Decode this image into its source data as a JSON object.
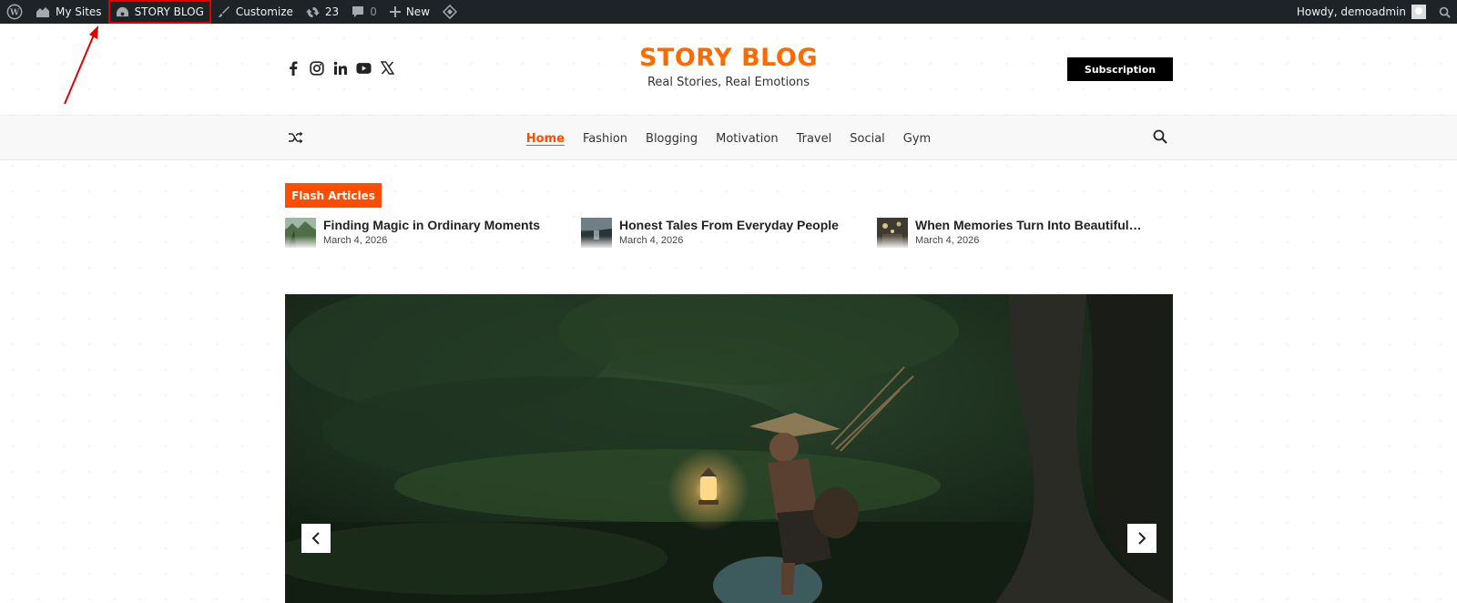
{
  "adminbar": {
    "my_sites": "My Sites",
    "site_name": "STORY BLOG",
    "customize": "Customize",
    "updates_count": "23",
    "comments_count": "0",
    "new": "New",
    "howdy": "Howdy, demoadmin"
  },
  "header": {
    "site_title": "STORY BLOG",
    "tagline": "Real Stories, Real Emotions",
    "subscribe_label": "Subscription",
    "social": [
      "facebook-icon",
      "instagram-icon",
      "linkedin-icon",
      "youtube-icon",
      "x-icon"
    ]
  },
  "nav": {
    "items": [
      {
        "label": "Home",
        "active": true
      },
      {
        "label": "Fashion"
      },
      {
        "label": "Blogging"
      },
      {
        "label": "Motivation"
      },
      {
        "label": "Travel"
      },
      {
        "label": "Social"
      },
      {
        "label": "Gym"
      }
    ]
  },
  "flash": {
    "label": "Flash Articles",
    "items": [
      {
        "title": "Finding Magic in Ordinary Moments",
        "date": "March 4, 2026"
      },
      {
        "title": "Honest Tales From Everyday People",
        "date": "March 4, 2026"
      },
      {
        "title": "When Memories Turn Into Beautiful…",
        "date": "March 4, 2026"
      }
    ]
  },
  "colors": {
    "accent": "#ff4d00",
    "brand": "#ff6a00",
    "adminbar": "#1d2327"
  }
}
